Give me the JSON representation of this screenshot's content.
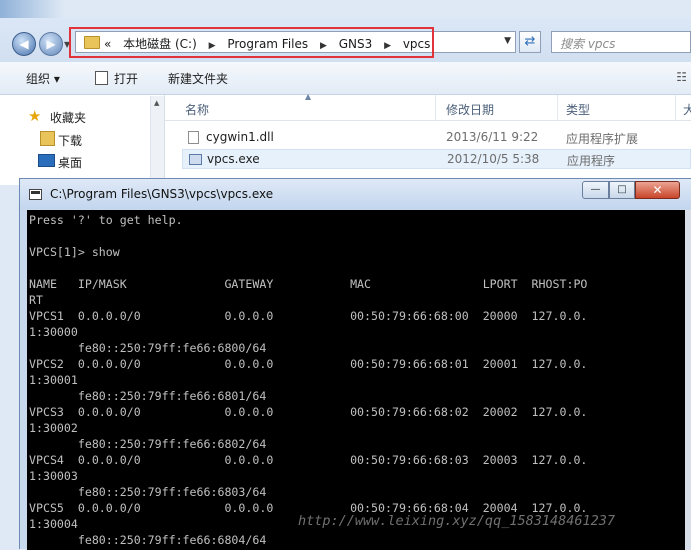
{
  "explorer": {
    "address": {
      "overflow": "«",
      "crumbs": [
        "本地磁盘 (C:)",
        "Program Files",
        "GNS3",
        "vpcs"
      ]
    },
    "search_placeholder": "搜索 vpcs",
    "toolbar": {
      "organize": "组织 ▾",
      "open": "打开",
      "new_folder": "新建文件夹"
    },
    "nav_pane": {
      "items": [
        "收藏夹",
        "下载",
        "桌面"
      ]
    },
    "columns": {
      "name": "名称",
      "date": "修改日期",
      "type": "类型",
      "size": "大"
    },
    "files": [
      {
        "name": "cygwin1.dll",
        "date": "2013/6/11 9:22",
        "type": "应用程序扩展"
      },
      {
        "name": "vpcs.exe",
        "date": "2012/10/5 5:38",
        "type": "应用程序"
      }
    ]
  },
  "console": {
    "title": "C:\\Program Files\\GNS3\\vpcs\\vpcs.exe",
    "buttons": {
      "minimize": "—",
      "maximize": "□",
      "close": "✕"
    },
    "text": "Press '?' to get help.\n\nVPCS[1]> show\n\nNAME   IP/MASK              GATEWAY           MAC                LPORT  RHOST:PO\nRT\nVPCS1  0.0.0.0/0            0.0.0.0           00:50:79:66:68:00  20000  127.0.0.\n1:30000\n       fe80::250:79ff:fe66:6800/64\nVPCS2  0.0.0.0/0            0.0.0.0           00:50:79:66:68:01  20001  127.0.0.\n1:30001\n       fe80::250:79ff:fe66:6801/64\nVPCS3  0.0.0.0/0            0.0.0.0           00:50:79:66:68:02  20002  127.0.0.\n1:30002\n       fe80::250:79ff:fe66:6802/64\nVPCS4  0.0.0.0/0            0.0.0.0           00:50:79:66:68:03  20003  127.0.0.\n1:30003\n       fe80::250:79ff:fe66:6803/64\nVPCS5  0.0.0.0/0            0.0.0.0           00:50:79:66:68:04  20004  127.0.0.\n1:30004\n       fe80::250:79ff:fe66:6804/64"
  },
  "watermark": "http://www.leixing.xyz/qq_1583148461237",
  "colors": {
    "highlight_box": "#e0343a",
    "console_bg": "#000000",
    "console_fg": "#c0c0c0"
  }
}
